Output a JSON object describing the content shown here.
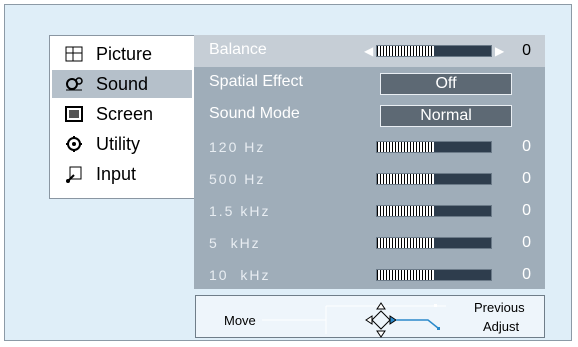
{
  "menu": {
    "items": [
      {
        "label": "Picture",
        "icon": "picture-icon"
      },
      {
        "label": "Sound",
        "icon": "sound-icon",
        "selected": true
      },
      {
        "label": "Screen",
        "icon": "screen-icon"
      },
      {
        "label": "Utility",
        "icon": "utility-icon"
      },
      {
        "label": "Input",
        "icon": "input-icon"
      }
    ]
  },
  "settings": {
    "balance": {
      "label": "Balance",
      "value": "0",
      "level": 0.5
    },
    "spatial_effect": {
      "label": "Spatial Effect",
      "value": "Off"
    },
    "sound_mode": {
      "label": "Sound Mode",
      "value": "Normal"
    },
    "eq": [
      {
        "label": "120 Hz",
        "value": "0",
        "level": 0.5
      },
      {
        "label": "500 Hz",
        "value": "0",
        "level": 0.5
      },
      {
        "label": "1.5 kHz",
        "value": "0",
        "level": 0.5
      },
      {
        "label": "5  kHz",
        "value": "0",
        "level": 0.5
      },
      {
        "label": "10  kHz",
        "value": "0",
        "level": 0.5
      }
    ]
  },
  "help": {
    "move": "Move",
    "previous": "Previous",
    "adjust": "Adjust"
  },
  "colors": {
    "panel": "#9fadb9",
    "selected": "#b5c0ca",
    "background": "#dfeef8"
  }
}
